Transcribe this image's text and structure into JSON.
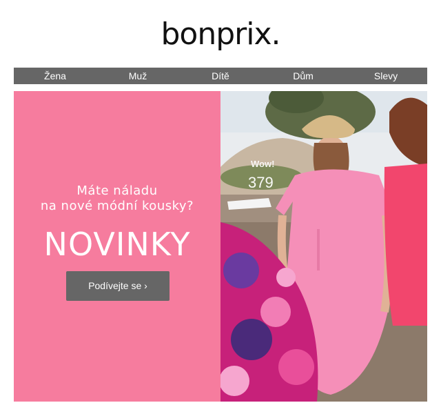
{
  "brand": {
    "logo_text": "bonprix."
  },
  "nav": {
    "items": [
      {
        "label": "Žena"
      },
      {
        "label": "Muž"
      },
      {
        "label": "Dítě"
      },
      {
        "label": "Dům"
      },
      {
        "label": "Slevy"
      }
    ]
  },
  "hero": {
    "subtitle_line1": "Máte náladu",
    "subtitle_line2": "na nové módní kousky?",
    "headline": "NOVINKY",
    "cta_label": "Podívejte se ›",
    "colors": {
      "panel": "#f67c9e",
      "button": "#666666"
    }
  },
  "photo_overlay": {
    "label": "Wow!",
    "count": "379"
  }
}
